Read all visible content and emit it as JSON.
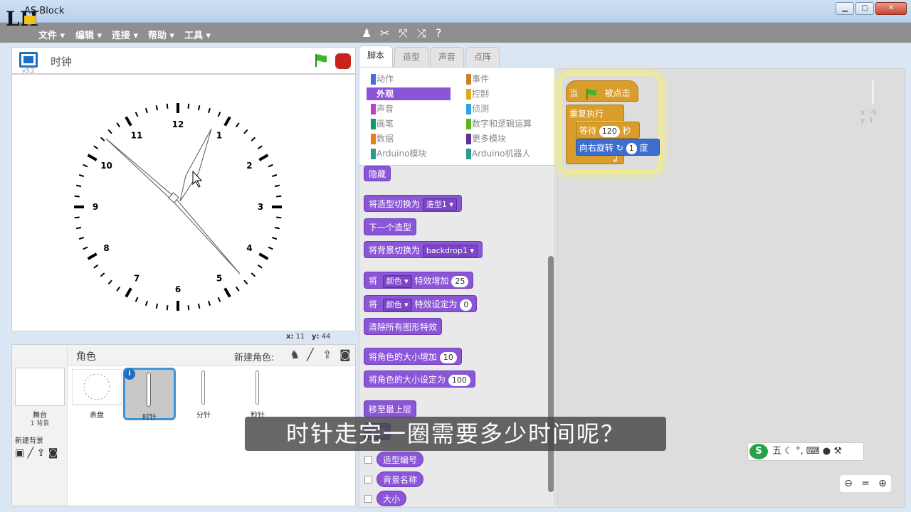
{
  "window": {
    "title": "AS-Block",
    "min": "▁",
    "max": "▢",
    "close": "✕"
  },
  "logo": "LH",
  "menu": [
    "文件 ▾",
    "编辑 ▾",
    "连接 ▾",
    "帮助 ▾",
    "工具 ▾"
  ],
  "toolbar_icons": [
    "duplicate-icon",
    "cut-icon",
    "grow-icon",
    "shrink-icon",
    "help-icon"
  ],
  "stage_header": {
    "version": "v3.2",
    "sprite_name": "时钟"
  },
  "stage_coords": {
    "x_label": "x:",
    "x": "11",
    "y_label": "y:",
    "y": "44"
  },
  "clock_numbers": [
    "12",
    "1",
    "2",
    "3",
    "4",
    "5",
    "6",
    "7",
    "8",
    "9",
    "10",
    "11"
  ],
  "sprite_pane": {
    "title": "角色",
    "new_sprite": "新建角色:",
    "stage_label": "舞台",
    "stage_backdrops": "1 背景",
    "new_backdrop": "新建背景",
    "sprites": [
      "表盘",
      "时针",
      "分针",
      "秒针"
    ]
  },
  "tabs": [
    "脚本",
    "造型",
    "声音",
    "点阵"
  ],
  "categories_left": [
    "动作",
    "外观",
    "声音",
    "画笔",
    "数据",
    "Arduino模块"
  ],
  "categories_right": [
    "事件",
    "控制",
    "侦测",
    "数字和逻辑运算",
    "更多模块",
    "Arduino机器人"
  ],
  "category_colors": {
    "left": [
      "#4a6cd4",
      "#8a55d7",
      "#bb42c3",
      "#0e9a6c",
      "#ee7d16",
      "#2a9b8e"
    ],
    "right": [
      "#c88330",
      "#e1a91a",
      "#2ca5e2",
      "#5cb712",
      "#632d99",
      "#2a9b8e"
    ]
  },
  "blocks": {
    "hide": "隐藏",
    "switch_costume": "将造型切换为",
    "costume_value": "造型1 ▾",
    "next_costume": "下一个造型",
    "switch_backdrop": "将背景切换为",
    "backdrop_value": "backdrop1 ▾",
    "change_effect_pre": "将",
    "effect_name": "颜色 ▾",
    "change_effect_post": "特效增加",
    "change_effect_value": "25",
    "set_effect_pre": "将",
    "set_effect_post": "特效设定为",
    "set_effect_value": "0",
    "clear_effects": "清除所有图形特效",
    "change_size": "将角色的大小增加",
    "change_size_value": "10",
    "set_size": "将角色的大小设定为",
    "set_size_value": "100",
    "go_front": "移至最上层",
    "go_back_prefix": "下移",
    "costume_number": "造型编号",
    "backdrop_name": "背景名称",
    "size": "大小"
  },
  "script": {
    "when_pre": "当",
    "when_post": "被点击",
    "forever": "重复执行",
    "wait_pre": "等待",
    "wait_value": "120",
    "wait_post": "秒",
    "turn_pre": "向右旋转",
    "turn_value": "1",
    "turn_post": "度"
  },
  "sprite_xy": {
    "x": "x: -9",
    "y": "y: 1"
  },
  "ime": "五",
  "subtitle": "时针走完一圈需要多少时间呢？"
}
